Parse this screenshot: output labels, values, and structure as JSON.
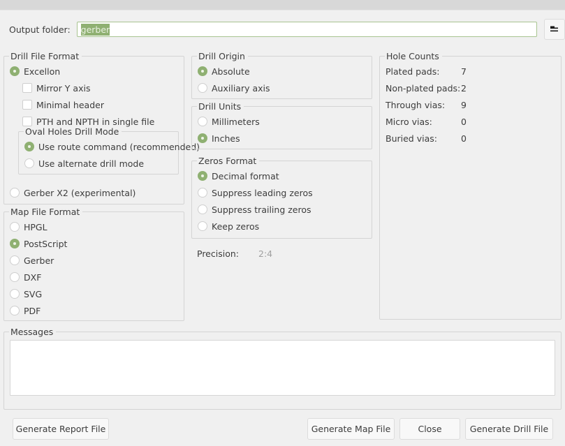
{
  "output_folder": {
    "label": "Output folder:",
    "value": "gerber",
    "browse_icon": "folder-open-icon"
  },
  "drill_file_format": {
    "legend": "Drill File Format",
    "options": [
      {
        "label": "Excellon",
        "selected": true
      },
      {
        "label": "Gerber X2 (experimental)",
        "selected": false
      }
    ],
    "checkboxes": [
      {
        "label": "Mirror Y axis",
        "checked": false
      },
      {
        "label": "Minimal header",
        "checked": false
      },
      {
        "label": "PTH and NPTH in single file",
        "checked": false
      }
    ],
    "oval_holes": {
      "legend": "Oval Holes Drill Mode",
      "options": [
        {
          "label": "Use route command (recommended)",
          "selected": true
        },
        {
          "label": "Use alternate drill mode",
          "selected": false
        }
      ]
    }
  },
  "map_file_format": {
    "legend": "Map File Format",
    "options": [
      {
        "label": "HPGL",
        "selected": false
      },
      {
        "label": "PostScript",
        "selected": true
      },
      {
        "label": "Gerber",
        "selected": false
      },
      {
        "label": "DXF",
        "selected": false
      },
      {
        "label": "SVG",
        "selected": false
      },
      {
        "label": "PDF",
        "selected": false
      }
    ]
  },
  "drill_origin": {
    "legend": "Drill Origin",
    "options": [
      {
        "label": "Absolute",
        "selected": true
      },
      {
        "label": "Auxiliary axis",
        "selected": false
      }
    ]
  },
  "drill_units": {
    "legend": "Drill Units",
    "options": [
      {
        "label": "Millimeters",
        "selected": false
      },
      {
        "label": "Inches",
        "selected": true
      }
    ]
  },
  "zeros_format": {
    "legend": "Zeros Format",
    "options": [
      {
        "label": "Decimal format",
        "selected": true
      },
      {
        "label": "Suppress leading zeros",
        "selected": false
      },
      {
        "label": "Suppress trailing zeros",
        "selected": false
      },
      {
        "label": "Keep zeros",
        "selected": false
      }
    ]
  },
  "precision": {
    "label": "Precision:",
    "value": "2:4"
  },
  "hole_counts": {
    "legend": "Hole Counts",
    "rows": [
      {
        "name": "Plated pads:",
        "value": "7"
      },
      {
        "name": "Non-plated pads:",
        "value": "2"
      },
      {
        "name": "Through vias:",
        "value": "9"
      },
      {
        "name": "Micro vias:",
        "value": "0"
      },
      {
        "name": "Buried vias:",
        "value": "0"
      }
    ]
  },
  "messages": {
    "legend": "Messages",
    "content": ""
  },
  "buttons": {
    "generate_report": "Generate Report File",
    "generate_map": "Generate Map File",
    "close": "Close",
    "generate_drill": "Generate Drill File"
  },
  "colors": {
    "accent_green": "#8fb072",
    "background": "#f0f0f0",
    "text": "#3c3c3c",
    "disabled_text": "#a0a0a0"
  }
}
